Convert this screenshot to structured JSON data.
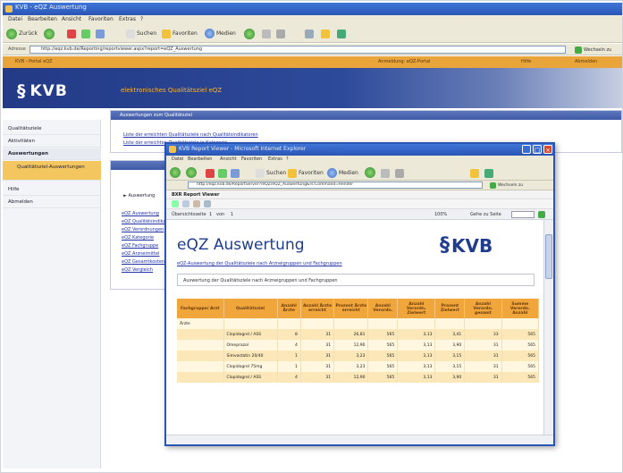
{
  "browser": {
    "title": "KVB - eQZ Auswertung",
    "menu": [
      "Datei",
      "Bearbeiten",
      "Ansicht",
      "Favoriten",
      "Extras",
      "?"
    ],
    "toolbar": {
      "back": "Zurück",
      "search": "Suchen",
      "favorites": "Favoriten",
      "media": "Medien"
    },
    "address_label": "Adresse",
    "address": "http://eqz.kvb.de/Reporting/reportviewer.aspx?report=eQZ_Auswertung",
    "go_label": "Wechseln zu"
  },
  "status_bar": {
    "left": "KVB - Portal eQZ",
    "middle": "Anmeldung: eQZ-Portal",
    "right1": "Hilfe",
    "right2": "Abmelden"
  },
  "header": {
    "logo_text": "KVB",
    "subtitle": "elektronisches Qualitätsziel eQZ"
  },
  "sidebar": {
    "items": [
      {
        "label": "Qualitätsziele"
      },
      {
        "label": "Aktivitäten"
      },
      {
        "label": "Auswertungen"
      },
      {
        "label": "Qualitätsziel-Auswertungen"
      },
      {
        "label": "Hilfe"
      },
      {
        "label": "Abmelden"
      }
    ]
  },
  "content": {
    "panel1_title": "Auswertungen zum Qualitätsziel",
    "panel1_links": [
      "Liste der erreichten Qualitätsziele nach Qualitätsindikatoren",
      "Liste der erreichten Qualitätsziele je Kategorie"
    ],
    "panel2_title": "Auswertung",
    "panel2_item": "Auswertung",
    "panel2_links": [
      "eQZ Auswertung",
      "eQZ Qualitätsindikator",
      "eQZ Verordnungen",
      "eQZ Kategorie",
      "eQZ Fachgruppe",
      "eQZ Arzneimittel",
      "eQZ Gesamtkosten",
      "eQZ Vergleich"
    ]
  },
  "popup": {
    "title": "KVB Report Viewer - Microsoft Internet Explorer",
    "menu": [
      "Datei",
      "Bearbeiten",
      "Ansicht",
      "Favoriten",
      "Extras",
      "?"
    ],
    "address": "http://eqz.kvb.de/ReportServer?/eQZ/eQZ_Auswertung&rs:Command=Render",
    "go_label": "Wechseln zu",
    "report_name": "BXR Report Viewer",
    "page_label": "Übersichtsseite",
    "page_current": "1",
    "page_of": "von",
    "page_total": "1",
    "zoom_label": "100%",
    "goto_label": "Gehe zu Seite",
    "report": {
      "title": "eQZ Auswertung",
      "logo_text": "KVB",
      "subtitle": "eQZ-Auswertung der Qualitätsziele nach Arzneigruppen und Fachgruppen",
      "section_label": "Auswertung der Qualitätsziele nach Arzneigruppen und Fachgruppen",
      "table": {
        "headers": [
          "Fachgruppe/ Arzt",
          "Qualitätsziel",
          "Anzahl Ärzte",
          "Anzahl Ärzte erreicht",
          "Prozent Ärzte erreicht",
          "Anzahl Verordn.",
          "Anzahl Verordn. Zielwert",
          "Prozent Zielwert",
          "Anzahl Verordn. gesamt",
          "Summe Verordn. Anzahl"
        ],
        "group_label": "Ärzte",
        "rows": [
          [
            "",
            "Clopidogrel / ASS",
            "8",
            "31",
            "26,81",
            "565",
            "3,13",
            "3,41",
            "33",
            "565"
          ],
          [
            "",
            "Omeprazol",
            "4",
            "31",
            "12,90",
            "565",
            "3,13",
            "3,90",
            "31",
            "565"
          ],
          [
            "",
            "Simvastatin 20/40",
            "1",
            "31",
            "3,23",
            "565",
            "3,13",
            "3,15",
            "31",
            "565"
          ],
          [
            "",
            "Clopidogrel 75mg",
            "1",
            "31",
            "3,23",
            "565",
            "3,13",
            "3,15",
            "31",
            "565"
          ],
          [
            "",
            "Clopidogrel / ASS",
            "4",
            "31",
            "12,90",
            "565",
            "3,13",
            "3,90",
            "31",
            "565"
          ]
        ]
      }
    }
  },
  "colors": {
    "brand_blue": "#233a86",
    "accent_orange": "#e9a43a",
    "xp_title": "#2a55b5"
  }
}
